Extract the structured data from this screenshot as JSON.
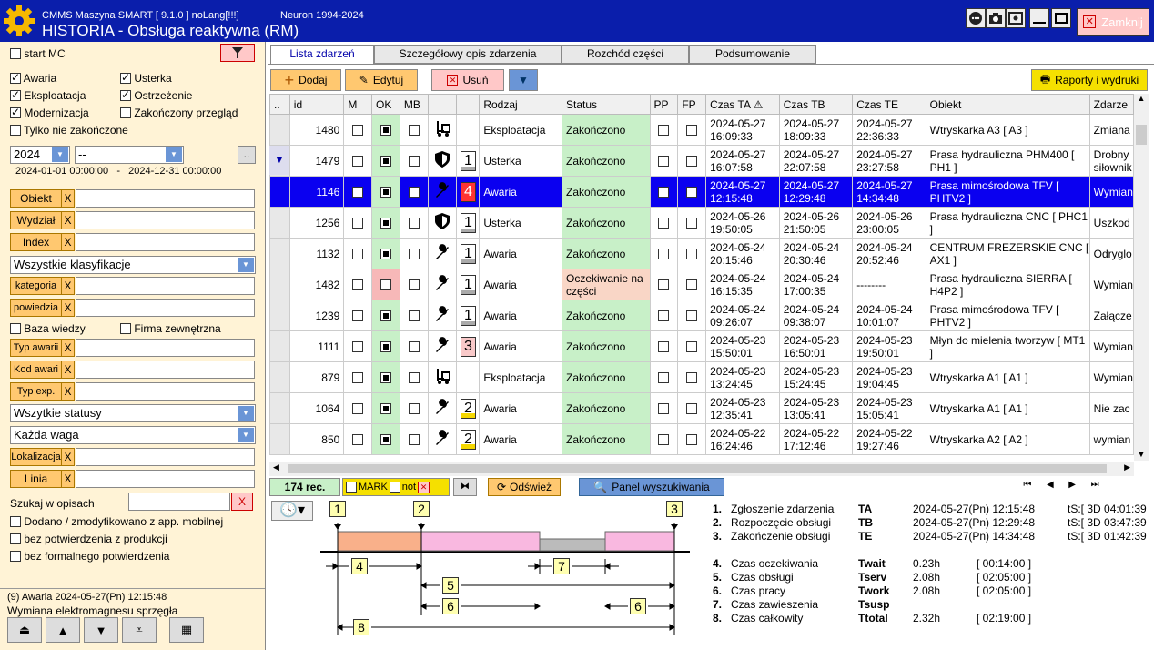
{
  "app": {
    "name": "CMMS Maszyna SMART  [ 9.1.0 ]  noLang[!!!]",
    "neuron": "Neuron 1994-2024",
    "title": "HISTORIA - Obsługa reaktywna (RM)",
    "close_label": "Zamknij"
  },
  "left": {
    "start_mc": "start MC",
    "filters": [
      {
        "label": "Awaria",
        "checked": true
      },
      {
        "label": "Usterka",
        "checked": true
      },
      {
        "label": "Eksploatacja",
        "checked": true
      },
      {
        "label": "Ostrzeżenie",
        "checked": true
      },
      {
        "label": "Modernizacja",
        "checked": true
      },
      {
        "label": "Zakończony przegląd",
        "checked": false
      }
    ],
    "only_unfinished": "Tylko nie zakończone",
    "year": "2024",
    "month": "--",
    "more": "..",
    "date_from": "2024-01-01  00:00:00",
    "date_sep": "-",
    "date_to": "2024-12-31  00:00:00",
    "obiekt": "Obiekt",
    "wydzial": "Wydział",
    "index": "Index",
    "klasyfikacje": "Wszystkie klasyfikacje",
    "kategoria": "kategoria",
    "powiedzia": "powiedzia",
    "baza_wiedzy": "Baza wiedzy",
    "firma": "Firma zewnętrzna",
    "typ_awarii": "Typ awarii",
    "kod_awari": "Kod awari",
    "typ_exp": "Typ exp.",
    "statusy": "Wszytkie statusy",
    "waga": "Każda waga",
    "lokalizacja": "Lokalizacja",
    "linia": "Linia",
    "x": "X",
    "szukaj": "Szukaj w opisach",
    "opt1": "Dodano / zmodyfikowano z app. mobilnej",
    "opt2": "bez potwierdzenia z produkcji",
    "opt3": "bez formalnego potwierdzenia",
    "sel_info": "(9)  Awaria  2024-05-27(Pn) 12:15:48",
    "sel_desc": "Wymiana elektromagnesu sprzęgła"
  },
  "tabs": [
    "Lista zdarzeń",
    "Szczegółowy opis zdarzenia",
    "Rozchód części",
    "Podsumowanie"
  ],
  "toolbar": {
    "add": "Dodaj",
    "edit": "Edytuj",
    "delete": "Usuń",
    "reports": "Raporty i wydruki"
  },
  "columns": [
    "..",
    "id",
    "M",
    "OK",
    "MB",
    "",
    "",
    "Rodzaj",
    "Status",
    "PP",
    "FP",
    "Czas TA",
    "Czas TB",
    "Czas TE",
    "Obiekt",
    "Zdarze"
  ],
  "rows": [
    {
      "id": "1480",
      "ok": true,
      "icon": "forklift",
      "prio": "",
      "rodzaj": "Eksploatacja",
      "status": "Zakończono",
      "ta": [
        "2024-05-27",
        "16:09:33"
      ],
      "tb": [
        "2024-05-27",
        "18:09:33"
      ],
      "te": [
        "2024-05-27",
        "22:36:33"
      ],
      "obiekt": "Wtryskarka A3 [ A3 ]",
      "zd": "Zmiana"
    },
    {
      "id": "1479",
      "ok": true,
      "icon": "shield",
      "prio": "1",
      "rodzaj": "Usterka",
      "status": "Zakończono",
      "ta": [
        "2024-05-27",
        "16:07:58"
      ],
      "tb": [
        "2024-05-27",
        "22:07:58"
      ],
      "te": [
        "2024-05-27",
        "23:27:58"
      ],
      "obiekt": "Prasa hydrauliczna PHM400 [ PH1 ]",
      "zd": "Drobny siłownik"
    },
    {
      "id": "1146",
      "ok": true,
      "icon": "wrench",
      "prio": "4",
      "rodzaj": "Awaria",
      "status": "Zakończono",
      "ta": [
        "2024-05-27",
        "12:15:48"
      ],
      "tb": [
        "2024-05-27",
        "12:29:48"
      ],
      "te": [
        "2024-05-27",
        "14:34:48"
      ],
      "obiekt": "Prasa mimośrodowa TFV [ PHTV2 ]",
      "zd": "Wymian",
      "selected": true
    },
    {
      "id": "1256",
      "ok": true,
      "icon": "shield",
      "prio": "1",
      "rodzaj": "Usterka",
      "status": "Zakończono",
      "ta": [
        "2024-05-26",
        "19:50:05"
      ],
      "tb": [
        "2024-05-26",
        "21:50:05"
      ],
      "te": [
        "2024-05-26",
        "23:00:05"
      ],
      "obiekt": "Prasa hydrauliczna CNC [ PHC1 ]",
      "zd": "Uszkod"
    },
    {
      "id": "1132",
      "ok": true,
      "icon": "wrench",
      "prio": "1",
      "rodzaj": "Awaria",
      "status": "Zakończono",
      "ta": [
        "2024-05-24",
        "20:15:46"
      ],
      "tb": [
        "2024-05-24",
        "20:30:46"
      ],
      "te": [
        "2024-05-24",
        "20:52:46"
      ],
      "obiekt": "CENTRUM FREZERSKIE CNC [ AX1 ]",
      "zd": "Odryglo"
    },
    {
      "id": "1482",
      "ok": false,
      "icon": "wrench",
      "prio": "1",
      "rodzaj": "Awaria",
      "status": "Oczekiwanie na części",
      "ta": [
        "2024-05-24",
        "16:15:35"
      ],
      "tb": [
        "2024-05-24",
        "17:00:35"
      ],
      "te": [
        "--------",
        ""
      ],
      "obiekt": "Prasa hydrauliczna SIERRA [ H4P2 ]",
      "zd": "Wymian"
    },
    {
      "id": "1239",
      "ok": true,
      "icon": "wrench",
      "prio": "1",
      "rodzaj": "Awaria",
      "status": "Zakończono",
      "ta": [
        "2024-05-24",
        "09:26:07"
      ],
      "tb": [
        "2024-05-24",
        "09:38:07"
      ],
      "te": [
        "2024-05-24",
        "10:01:07"
      ],
      "obiekt": "Prasa mimośrodowa TFV [ PHTV2 ]",
      "zd": "Załącze"
    },
    {
      "id": "1111",
      "ok": true,
      "icon": "wrench",
      "prio": "3",
      "rodzaj": "Awaria",
      "status": "Zakończono",
      "ta": [
        "2024-05-23",
        "15:50:01"
      ],
      "tb": [
        "2024-05-23",
        "16:50:01"
      ],
      "te": [
        "2024-05-23",
        "19:50:01"
      ],
      "obiekt": "Młyn do mielenia tworzyw [ MT1 ]",
      "zd": "Wymian"
    },
    {
      "id": "879",
      "ok": true,
      "icon": "forklift",
      "prio": "",
      "rodzaj": "Eksploatacja",
      "status": "Zakończono",
      "ta": [
        "2024-05-23",
        "13:24:45"
      ],
      "tb": [
        "2024-05-23",
        "15:24:45"
      ],
      "te": [
        "2024-05-23",
        "19:04:45"
      ],
      "obiekt": "Wtryskarka A1 [ A1 ]",
      "zd": "Wymian"
    },
    {
      "id": "1064",
      "ok": true,
      "icon": "wrench",
      "prio": "2",
      "rodzaj": "Awaria",
      "status": "Zakończono",
      "ta": [
        "2024-05-23",
        "12:35:41"
      ],
      "tb": [
        "2024-05-23",
        "13:05:41"
      ],
      "te": [
        "2024-05-23",
        "15:05:41"
      ],
      "obiekt": "Wtryskarka A1 [ A1 ]",
      "zd": "Nie zac"
    },
    {
      "id": "850",
      "ok": true,
      "icon": "wrench",
      "prio": "2",
      "rodzaj": "Awaria",
      "status": "Zakończono",
      "ta": [
        "2024-05-22",
        "16:24:46"
      ],
      "tb": [
        "2024-05-22",
        "17:12:46"
      ],
      "te": [
        "2024-05-22",
        "19:27:46"
      ],
      "obiekt": "Wtryskarka A2 [ A2 ]",
      "zd": "wymian"
    }
  ],
  "status": {
    "count": "174 rec.",
    "mark": "MARK",
    "not": "not",
    "refresh": "Odśwież",
    "search_panel": "Panel wyszukiwania"
  },
  "timeline": {
    "labels": [
      "1",
      "2",
      "3",
      "4",
      "5",
      "6",
      "7",
      "8"
    ]
  },
  "info": [
    {
      "n": "1.",
      "label": "Zgłoszenie zdarzenia",
      "code": "TA",
      "val": "2024-05-27(Pn) 12:15:48",
      "extra": "tS:[ 3D 04:01:39"
    },
    {
      "n": "2.",
      "label": "Rozpoczęcie obsługi",
      "code": "TB",
      "val": "2024-05-27(Pn) 12:29:48",
      "extra": "tS:[ 3D 03:47:39"
    },
    {
      "n": "3.",
      "label": "Zakończenie obsługi",
      "code": "TE",
      "val": "2024-05-27(Pn) 14:34:48",
      "extra": "tS:[ 3D 01:42:39"
    },
    {
      "n": "4.",
      "label": "Czas oczekiwania",
      "code": "Twait",
      "val": "0.23h",
      "extra": "[ 00:14:00 ]"
    },
    {
      "n": "5.",
      "label": "Czas obsługi",
      "code": "Tserv",
      "val": "2.08h",
      "extra": "[ 02:05:00 ]"
    },
    {
      "n": "6.",
      "label": "Czas pracy",
      "code": "Twork",
      "val": "2.08h",
      "extra": "[ 02:05:00 ]"
    },
    {
      "n": "7.",
      "label": "Czas zawieszenia",
      "code": "Tsusp",
      "val": "",
      "extra": ""
    },
    {
      "n": "8.",
      "label": "Czas całkowity",
      "code": "Ttotal",
      "val": "2.32h",
      "extra": "[ 02:19:00 ]"
    }
  ],
  "colors": {
    "title_bg": "#0a1eab",
    "left_bg": "#fff3d6",
    "ok_green": "#c8f0c8",
    "selected": "#0a00f0"
  }
}
